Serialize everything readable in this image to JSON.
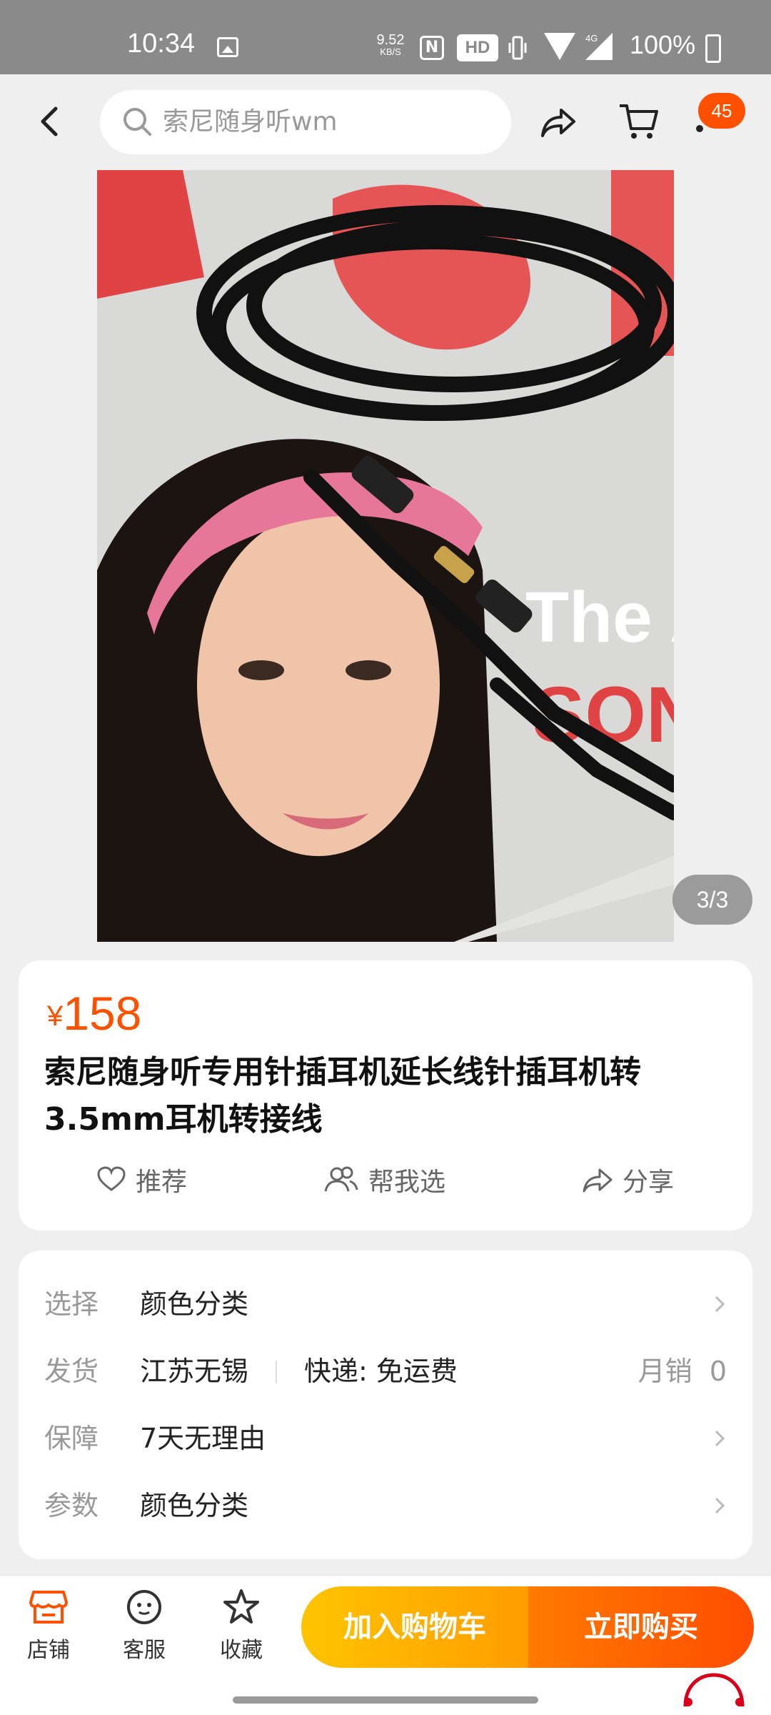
{
  "status_bar": {
    "time": "10:34",
    "net_speed_value": "9.52",
    "net_speed_unit": "KB/S",
    "hd": "HD",
    "network": "4G",
    "battery": "100%"
  },
  "search": {
    "placeholder": "索尼随身听wm"
  },
  "cart_badge": "45",
  "image_counter": "3/3",
  "product": {
    "currency": "¥",
    "price": "158",
    "title": "索尼随身听专用针插耳机延长线针插耳机转3.5mm耳机转接线"
  },
  "actions": {
    "recommend": "推荐",
    "help_choose": "帮我选",
    "share": "分享"
  },
  "info": {
    "select_label": "选择",
    "select_value": "颜色分类",
    "ship_label": "发货",
    "ship_from": "江苏无锡",
    "ship_express": "快递: 免运费",
    "monthly_sales_label": "月销",
    "monthly_sales_value": "0",
    "guarantee_label": "保障",
    "guarantee_value": "7天无理由",
    "params_label": "参数",
    "params_value": "颜色分类"
  },
  "bottom_bar": {
    "store": "店铺",
    "service": "客服",
    "favorite": "收藏",
    "add_to_cart": "加入购物车",
    "buy_now": "立即购买"
  },
  "colors": {
    "accent": "#ff5000",
    "cart_button": "#ffb300",
    "buy_button": "#ff5a00"
  }
}
